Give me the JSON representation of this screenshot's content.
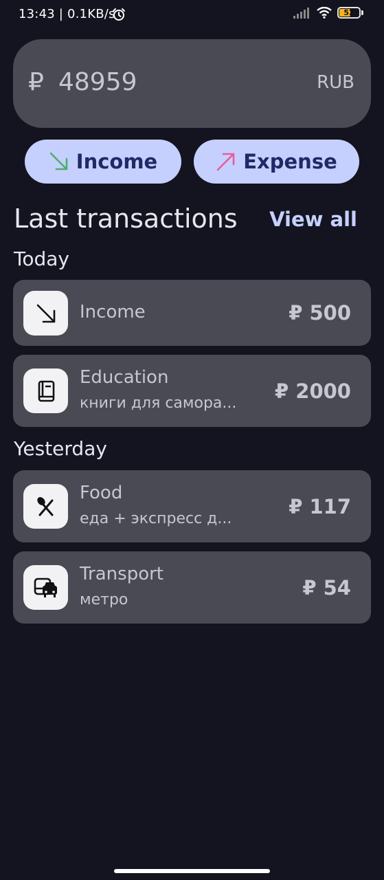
{
  "status_bar": {
    "time_speed": "13:43 | 0.1KB/s",
    "battery": "52",
    "battery_level": 0.52
  },
  "balance": {
    "symbol": "₽",
    "value": "48959",
    "currency": "RUB"
  },
  "actions": {
    "income_label": "Income",
    "expense_label": "Expense"
  },
  "colors": {
    "income_arrow": "#4caf6a",
    "expense_arrow": "#e85d9c",
    "accent": "#c6d0ff"
  },
  "section": {
    "title": "Last transactions",
    "view_all": "View all"
  },
  "groups": [
    {
      "label": "Today",
      "transactions": [
        {
          "icon": "arrow-down-right-icon",
          "title": "Income",
          "amount": "₽ 500"
        },
        {
          "icon": "book-icon",
          "title": "Education",
          "note": "книги для самора...",
          "amount": "₽ 2000"
        }
      ]
    },
    {
      "label": "Yesterday",
      "transactions": [
        {
          "icon": "fork-knife-icon",
          "title": "Food",
          "note": "еда + экспресс д...",
          "amount": "₽ 117"
        },
        {
          "icon": "transport-icon",
          "title": "Transport",
          "note": "метро",
          "amount": "₽ 54"
        }
      ]
    }
  ]
}
